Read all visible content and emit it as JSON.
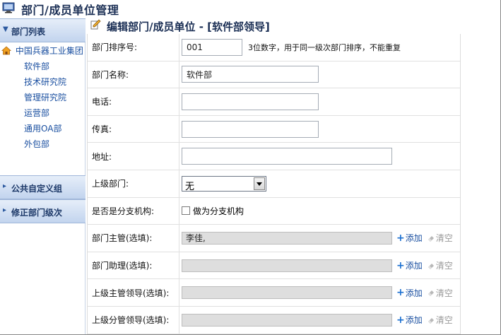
{
  "window": {
    "title": "部门/成员单位管理",
    "app_icon": "monitor-icon"
  },
  "sidebar": {
    "panels": [
      {
        "label": "部门列表",
        "expanded": true
      },
      {
        "label": "公共自定义组",
        "expanded": false
      },
      {
        "label": "修正部门级次",
        "expanded": false
      }
    ],
    "tree": {
      "root": {
        "label": "中国兵器工业集团",
        "icon": "home-icon"
      },
      "children": [
        "软件部",
        "技术研究院",
        "管理研究院",
        "运营部",
        "通用OA部",
        "外包部"
      ]
    }
  },
  "form": {
    "title": "编辑部门/成员单位 - [软件部领导]",
    "title_icon": "pen-icon",
    "fields": {
      "order": {
        "label": "部门排序号:",
        "value": "001",
        "hint": "3位数字，用于同一级次部门排序，不能重复"
      },
      "name": {
        "label": "部门名称:",
        "value": "软件部"
      },
      "phone": {
        "label": "电话:",
        "value": ""
      },
      "fax": {
        "label": "传真:",
        "value": ""
      },
      "address": {
        "label": "地址:",
        "value": ""
      },
      "parent": {
        "label": "上级部门:",
        "selected": "无"
      },
      "branch": {
        "label": "是否是分支机构:",
        "checkbox_label": "做为分支机构",
        "checked": false
      },
      "manager": {
        "label": "部门主管(选填):",
        "value": "李佳,"
      },
      "assistant": {
        "label": "部门助理(选填):",
        "value": ""
      },
      "sup_leader": {
        "label": "上级主管领导(选填):",
        "value": ""
      },
      "div_leader": {
        "label": "上级分管领导(选填):",
        "value": ""
      }
    },
    "actions": {
      "add_label": "添加",
      "clear_label": "清空"
    }
  },
  "colors": {
    "accent": "#1a4fa0",
    "panel_gradient_top": "#e6eef9",
    "panel_gradient_bottom": "#c2d4ee",
    "title": "#1b2f55"
  }
}
